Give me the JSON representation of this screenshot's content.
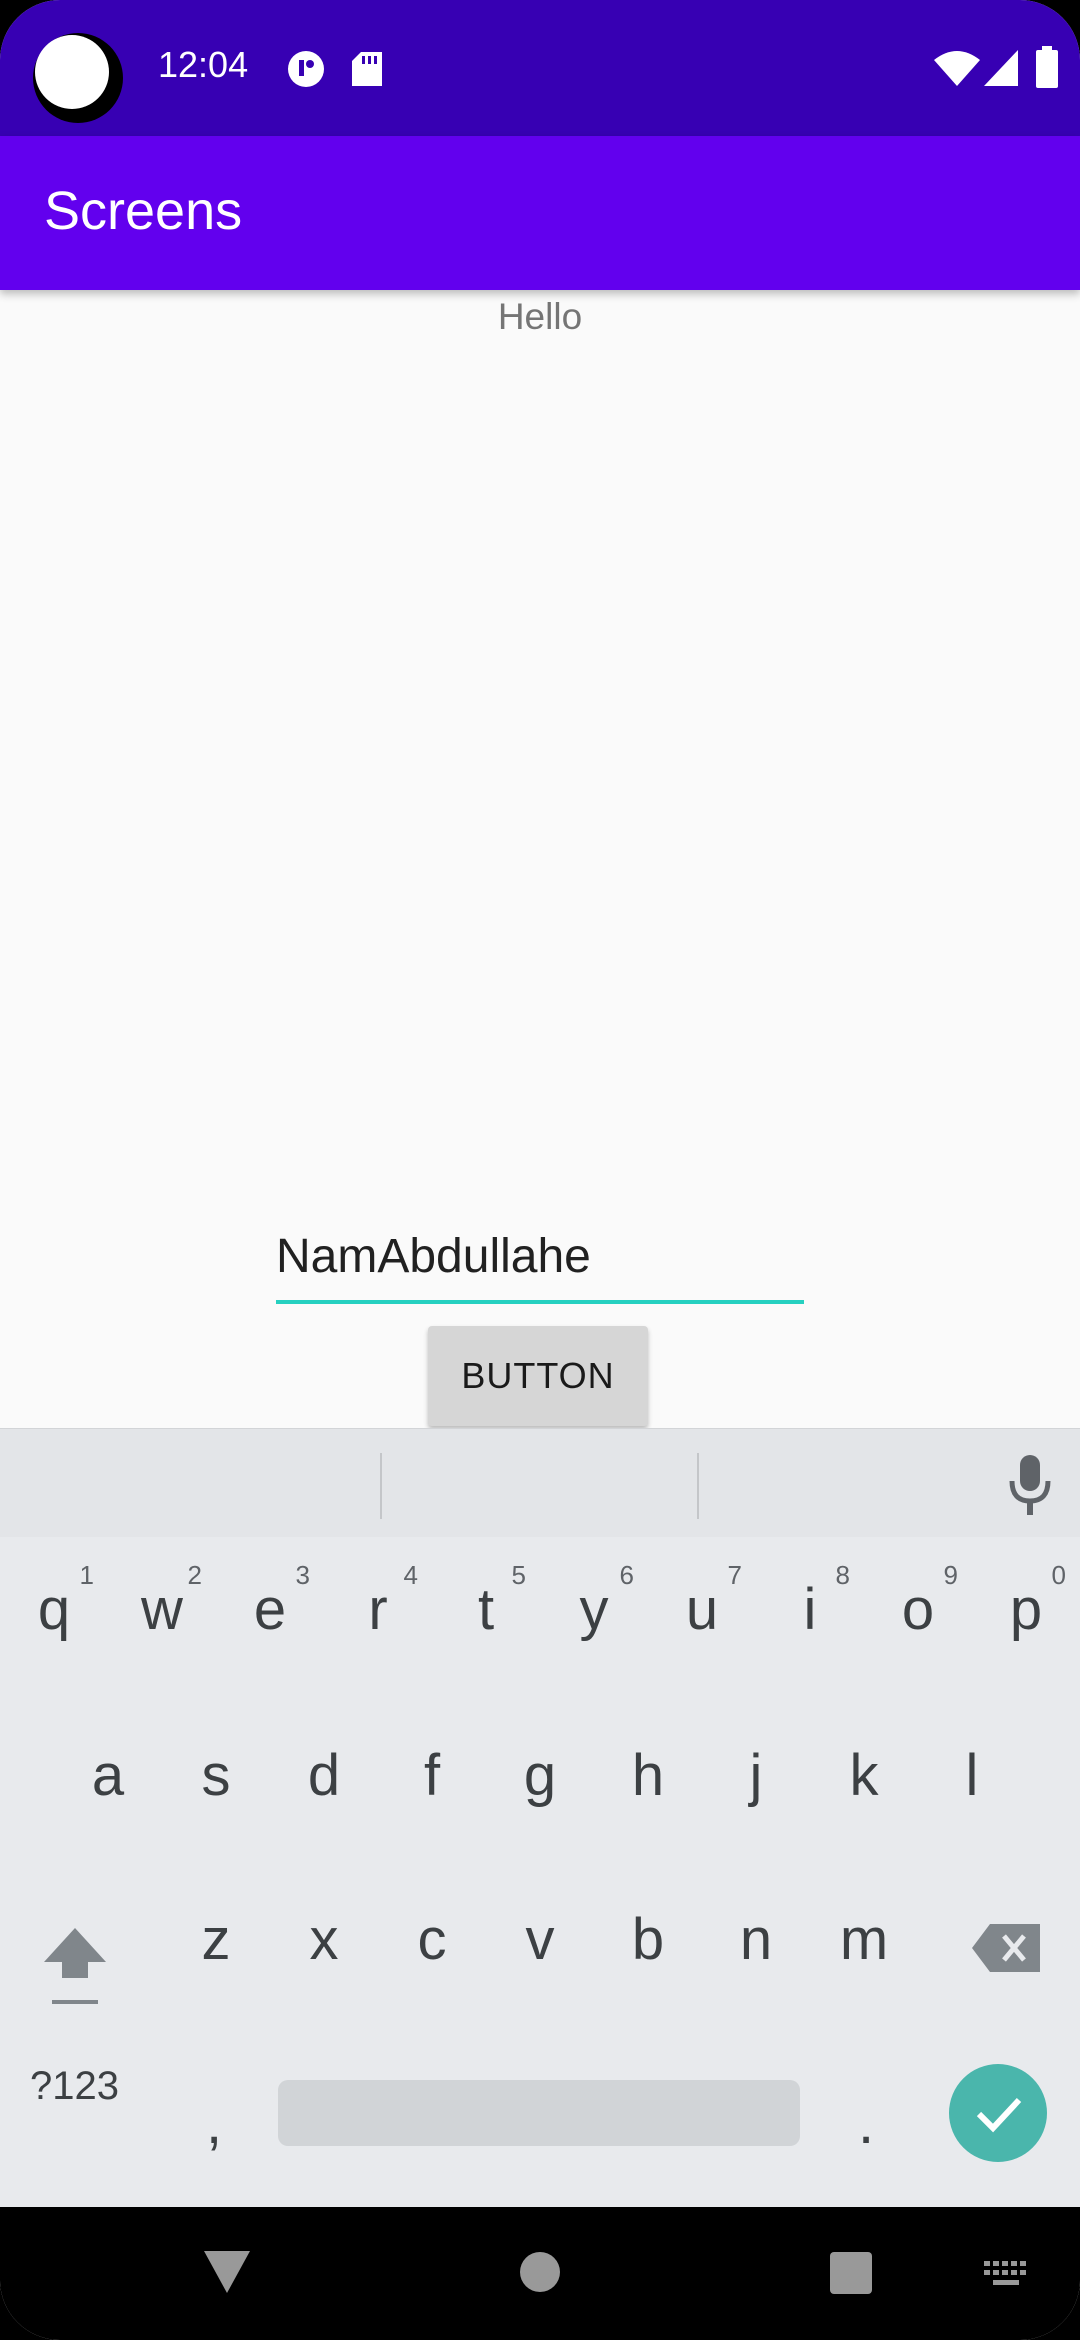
{
  "status_bar": {
    "time": "12:04",
    "icons": [
      "camera-cutout",
      "tiktok-icon",
      "sd-card-icon",
      "wifi-icon",
      "signal-icon",
      "battery-icon"
    ]
  },
  "app_bar": {
    "title": "Screens"
  },
  "content": {
    "hello_text": "Hello",
    "name_input_value": "NamAbdullahe",
    "button_label": "BUTTON"
  },
  "keyboard": {
    "row1": [
      {
        "key": "q",
        "hint": "1"
      },
      {
        "key": "w",
        "hint": "2"
      },
      {
        "key": "e",
        "hint": "3"
      },
      {
        "key": "r",
        "hint": "4"
      },
      {
        "key": "t",
        "hint": "5"
      },
      {
        "key": "y",
        "hint": "6"
      },
      {
        "key": "u",
        "hint": "7"
      },
      {
        "key": "i",
        "hint": "8"
      },
      {
        "key": "o",
        "hint": "9"
      },
      {
        "key": "p",
        "hint": "0"
      }
    ],
    "row2": [
      "a",
      "s",
      "d",
      "f",
      "g",
      "h",
      "j",
      "k",
      "l"
    ],
    "row3": [
      "z",
      "x",
      "c",
      "v",
      "b",
      "n",
      "m"
    ],
    "symbols_label": "?123",
    "comma_label": ",",
    "period_label": "."
  },
  "colors": {
    "status_bar": "#3700b3",
    "app_bar": "#6200ee",
    "input_underline": "#26d0c0",
    "enter_key": "#4ab6ac"
  },
  "nav_bar": {
    "icons": [
      "back-icon",
      "home-icon",
      "recents-icon",
      "keyboard-switch-icon"
    ]
  }
}
